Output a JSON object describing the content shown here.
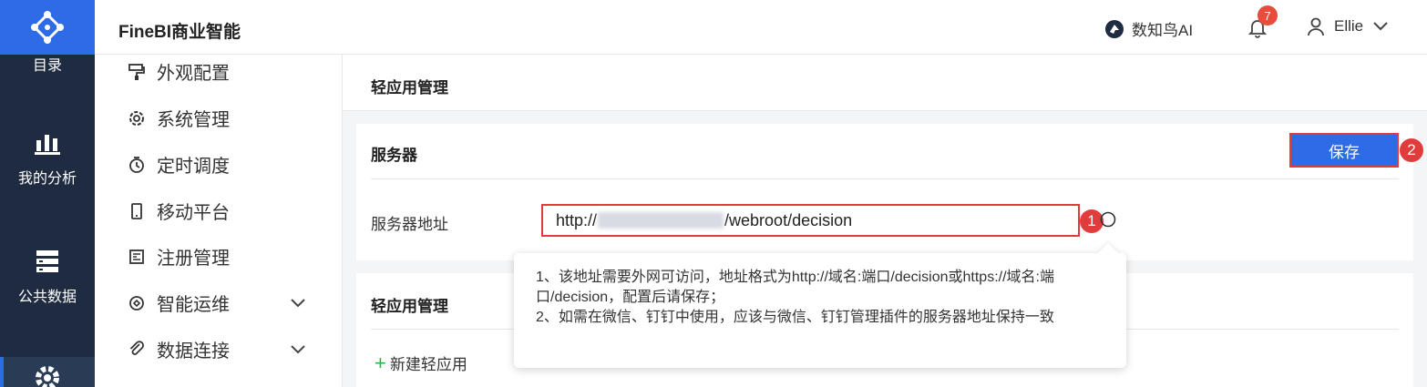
{
  "header": {
    "app_title": "FineBI商业智能",
    "brand": "数知鸟AI",
    "notification_count": "7",
    "user_name": "Ellie"
  },
  "leftnav": {
    "items": [
      {
        "label": "目录",
        "icon": "catalog-icon"
      },
      {
        "label": "我的分析",
        "icon": "analysis-chart-icon"
      },
      {
        "label": "公共数据",
        "icon": "database-icon"
      },
      {
        "label": "",
        "icon": "gear-icon"
      }
    ]
  },
  "menu": {
    "items": [
      {
        "label": "外观配置",
        "icon": "paint-roller-icon"
      },
      {
        "label": "系统管理",
        "icon": "gear-icon"
      },
      {
        "label": "定时调度",
        "icon": "timer-icon"
      },
      {
        "label": "移动平台",
        "icon": "mobile-icon"
      },
      {
        "label": "注册管理",
        "icon": "register-icon"
      },
      {
        "label": "智能运维",
        "icon": "ops-icon",
        "expandable": true
      },
      {
        "label": "数据连接",
        "icon": "link-icon",
        "expandable": true
      }
    ]
  },
  "page": {
    "title": "轻应用管理"
  },
  "server_card": {
    "title": "服务器",
    "save_label": "保存",
    "address_label": "服务器地址",
    "address_prefix": "http://",
    "address_suffix": "/webroot/decision",
    "step1": "1",
    "step2": "2"
  },
  "tooltip": {
    "line1": "1、该地址需要外网可访问，地址格式为http://域名:端口/decision或https://域名:端口/decision，配置后请保存；",
    "line2": "2、如需在微信、钉钉中使用，应该与微信、钉钉管理插件的服务器地址保持一致"
  },
  "app_card": {
    "title": "轻应用管理",
    "new_app_label": "新建轻应用"
  },
  "colors": {
    "primary": "#2e6be6",
    "nav_bg": "#1e2b40",
    "highlight_red": "#e03c3c",
    "badge_red": "#e84c3d",
    "add_green": "#2bb24c"
  }
}
